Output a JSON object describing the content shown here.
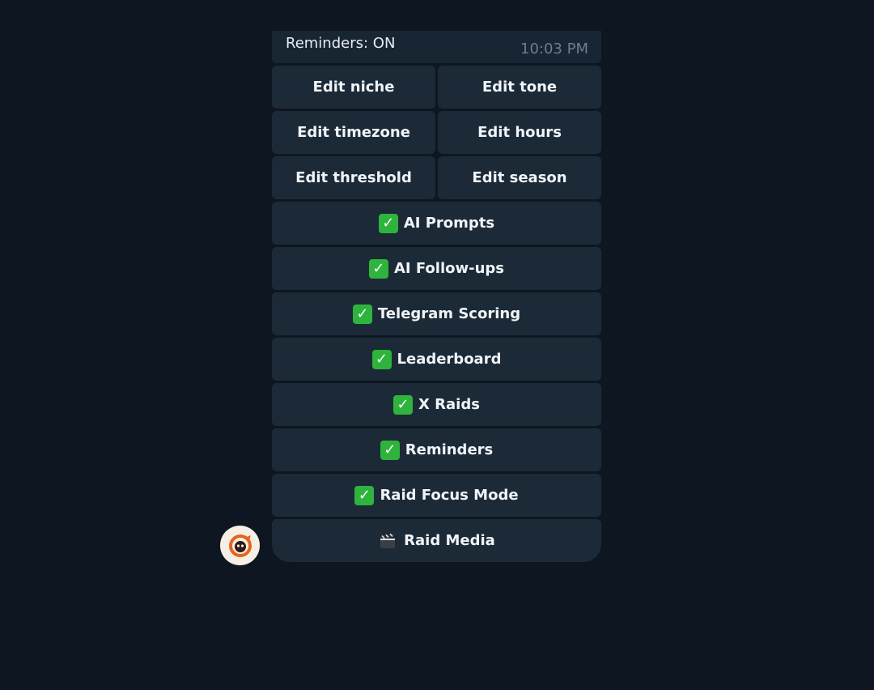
{
  "message": {
    "text": "Reminders: ON",
    "time": "10:03 PM"
  },
  "keyboard": {
    "rows": [
      [
        {
          "label": "Edit niche"
        },
        {
          "label": "Edit tone"
        }
      ],
      [
        {
          "label": "Edit timezone"
        },
        {
          "label": "Edit hours"
        }
      ],
      [
        {
          "label": "Edit threshold"
        },
        {
          "label": "Edit season"
        }
      ],
      [
        {
          "label": "AI Prompts",
          "icon": "check-mark-icon"
        }
      ],
      [
        {
          "label": "AI Follow-ups",
          "icon": "check-mark-icon"
        }
      ],
      [
        {
          "label": "Telegram Scoring",
          "icon": "check-mark-icon"
        }
      ],
      [
        {
          "label": "Leaderboard",
          "icon": "check-mark-icon"
        }
      ],
      [
        {
          "label": "X Raids",
          "icon": "check-mark-icon"
        }
      ],
      [
        {
          "label": "Reminders",
          "icon": "check-mark-icon"
        }
      ],
      [
        {
          "label": "Raid Focus Mode",
          "icon": "check-mark-icon"
        }
      ],
      [
        {
          "label": "Raid Media",
          "icon": "clapperboard-icon"
        }
      ]
    ]
  },
  "avatar": {
    "icon": "bot-avatar-icon"
  },
  "colors": {
    "background": "#0e1621",
    "bubble": "#182533",
    "button": "#1c2a38",
    "check": "#2eb43c",
    "avatar_accent": "#e8641c"
  }
}
